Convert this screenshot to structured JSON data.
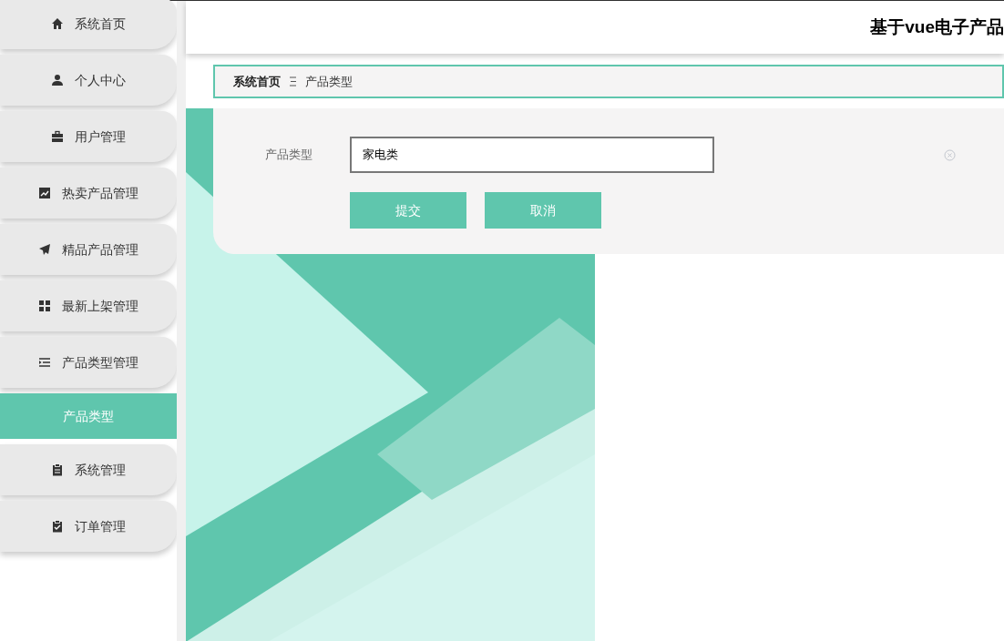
{
  "sidebar": {
    "items": [
      {
        "label": "系统首页"
      },
      {
        "label": "个人中心"
      },
      {
        "label": "用户管理"
      },
      {
        "label": "热卖产品管理"
      },
      {
        "label": "精品产品管理"
      },
      {
        "label": "最新上架管理"
      },
      {
        "label": "产品类型管理",
        "children": [
          {
            "label": "产品类型",
            "selected": true
          }
        ]
      },
      {
        "label": "系统管理"
      },
      {
        "label": "订单管理"
      }
    ]
  },
  "header": {
    "title": "基于vue电子产品"
  },
  "breadcrumb": [
    "系统首页",
    "产品类型"
  ],
  "form": {
    "fields": [
      {
        "label": "产品类型",
        "value": "家电类"
      }
    ],
    "buttons": [
      {
        "label": "提交"
      },
      {
        "label": "取消"
      }
    ]
  }
}
